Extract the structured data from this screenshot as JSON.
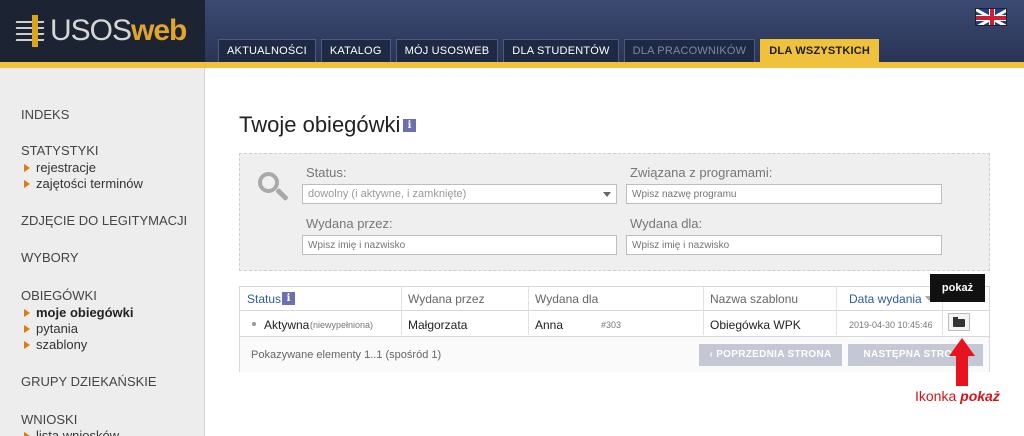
{
  "header": {
    "logo_text_a": "USOS",
    "logo_text_b": "web",
    "flag": "uk-flag-icon",
    "nav": [
      {
        "label": "AKTUALNOŚCI",
        "state": "normal"
      },
      {
        "label": "KATALOG",
        "state": "normal"
      },
      {
        "label": "MÓJ USOSWEB",
        "state": "normal"
      },
      {
        "label": "DLA STUDENTÓW",
        "state": "normal"
      },
      {
        "label": "DLA PRACOWNIKÓW",
        "state": "disabled"
      },
      {
        "label": "DLA WSZYSTKICH",
        "state": "active"
      }
    ]
  },
  "sidebar": {
    "indeks": "INDEKS",
    "statystyki": "STATYSTYKI",
    "rejestracje": "rejestracje",
    "zajetosci": "zajętości terminów",
    "zdjecie": "ZDJĘCIE DO LEGITYMACJI",
    "wybory": "WYBORY",
    "obiegowki": "OBIEGÓWKI",
    "moje_obiegowki": "moje obiegówki",
    "pytania": "pytania",
    "szablony": "szablony",
    "grupy": "GRUPY DZIEKAŃSKIE",
    "wnioski": "WNIOSKI",
    "lista_wnioskow": "lista wniosków"
  },
  "main": {
    "title": "Twoje obiegówki",
    "info_glyph": "i"
  },
  "filters": {
    "status_label": "Status:",
    "status_value": "dowolny (i aktywne, i zamknięte)",
    "programy_label": "Związana z programami:",
    "programy_placeholder": "Wpisz nazwę programu",
    "przez_label": "Wydana przez:",
    "przez_placeholder": "Wpisz imię i nazwisko",
    "dla_label": "Wydana dla:",
    "dla_placeholder": "Wpisz imię i nazwisko"
  },
  "table": {
    "columns": [
      "Status",
      "Wydana przez",
      "Wydana dla",
      "Nazwa szablonu",
      "Data wydania"
    ],
    "row": {
      "status": "Aktywna",
      "status_note": "(niewypełniona)",
      "wydana_przez": "Małgorzata",
      "wydana_dla": "Anna",
      "id": "#303",
      "szablon": "Obiegówka WPK",
      "data": "2019-04-30 10:45:46"
    },
    "footer_text": "Pokazywane elementy 1..1 (spośród 1)",
    "prev_label": "‹  POPRZEDNIA STRONA",
    "next_label": "NASTĘPNA STRONA"
  },
  "overlay": {
    "tooltip": "pokaż",
    "annotation_prefix": "Ikonka",
    "annotation_em": "pokaż",
    "accent": "#e8131e"
  }
}
